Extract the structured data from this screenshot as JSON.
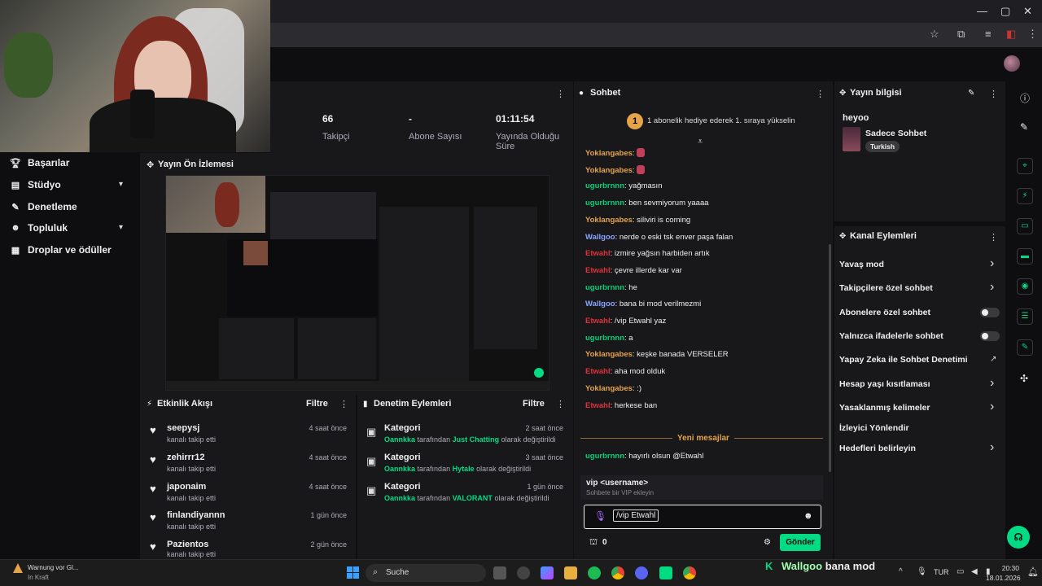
{
  "stats": [
    {
      "value": "66",
      "label": "Takipçi"
    },
    {
      "value": "-",
      "label": "Abone Sayısı"
    },
    {
      "value": "01:11:54",
      "label": "Yayında Olduğu Süre"
    }
  ],
  "sidebar": {
    "items": [
      {
        "label": "Başarılar",
        "icon": "trophy-icon"
      },
      {
        "label": "Stüdyo",
        "icon": "studio-icon"
      },
      {
        "label": "Denetleme",
        "icon": "wrench-icon"
      },
      {
        "label": "Topluluk",
        "icon": "community-icon"
      },
      {
        "label": "Droplar ve ödüller",
        "icon": "gift-icon"
      }
    ]
  },
  "preview": {
    "title": "Yayın Ön İzlemesi"
  },
  "activity": {
    "title": "Etkinlik Akışı",
    "filter": "Filtre",
    "items": [
      {
        "name": "seepysj",
        "sub": "kanalı takip etti",
        "time": "4 saat önce"
      },
      {
        "name": "zehirrr12",
        "sub": "kanalı takip etti",
        "time": "4 saat önce"
      },
      {
        "name": "japonaim",
        "sub": "kanalı takip etti",
        "time": "4 saat önce"
      },
      {
        "name": "finlandiyannn",
        "sub": "kanalı takip etti",
        "time": "1 gün önce"
      },
      {
        "name": "Pazientos",
        "sub": "kanalı takip etti",
        "time": "2 gün önce"
      }
    ]
  },
  "moderation": {
    "title": "Denetim Eylemleri",
    "filter": "Filtre",
    "items": [
      {
        "title": "Kategori",
        "user": "Oannkka",
        "mid": "tarafından",
        "cat": "Just Chatting",
        "end": "olarak değiştirildi",
        "time": "2 saat önce"
      },
      {
        "title": "Kategori",
        "user": "Oannkka",
        "mid": "tarafından",
        "cat": "Hytale",
        "end": "olarak değiştirildi",
        "time": "3 saat önce"
      },
      {
        "title": "Kategori",
        "user": "Oannkka",
        "mid": "tarafından",
        "cat": "VALORANT",
        "end": "olarak değiştirildi",
        "time": "1 gün önce"
      }
    ]
  },
  "chat": {
    "title": "Sohbet",
    "hype_count": "1",
    "hype_text": "1 abonelik hediye ederek 1. sıraya yükselin",
    "messages": [
      {
        "user": "Yoklangabes",
        "sep": ":",
        "text": "",
        "cls": "u-yok",
        "emote": true
      },
      {
        "user": "Yoklangabes",
        "sep": ":",
        "text": "",
        "cls": "u-yok",
        "emote": true
      },
      {
        "user": "ugurbrnnn",
        "sep": ":",
        "text": " yağmasın",
        "cls": "u-ugu"
      },
      {
        "user": "ugurbrnnn",
        "sep": ":",
        "text": " ben sevmiyorum yaaaa",
        "cls": "u-ugu"
      },
      {
        "user": "Yoklangabes",
        "sep": ":",
        "text": " siliviri is coming",
        "cls": "u-yok"
      },
      {
        "user": "Wallgoo",
        "sep": ":",
        "text": " nerde o eski tsk enver paşa falan",
        "cls": "u-wal"
      },
      {
        "user": "Etwahl",
        "sep": ":",
        "text": " izmire yağsın harbiden artık",
        "cls": "u-etw"
      },
      {
        "user": "Etwahl",
        "sep": ":",
        "text": " çevre illerde kar var",
        "cls": "u-etw"
      },
      {
        "user": "ugurbrnnn",
        "sep": ":",
        "text": " he",
        "cls": "u-ugu"
      },
      {
        "user": "Wallgoo",
        "sep": ":",
        "text": " bana bi mod verilmezmi",
        "cls": "u-wal"
      },
      {
        "user": "Etwahl",
        "sep": ":",
        "text": " /vip Etwahl yaz",
        "cls": "u-etw"
      },
      {
        "user": "ugurbrnnn",
        "sep": ":",
        "text": " a",
        "cls": "u-ugu"
      },
      {
        "user": "Yoklangabes",
        "sep": ":",
        "text": " keşke banada VERSELER",
        "cls": "u-yok"
      },
      {
        "user": "Etwahl",
        "sep": ":",
        "text": " aha mod olduk",
        "cls": "u-etw"
      },
      {
        "user": "Yoklangabes",
        "sep": ":",
        "text": " :)",
        "cls": "u-yok"
      },
      {
        "user": "Etwahl",
        "sep": ":",
        "text": " herkese ban",
        "cls": "u-etw"
      }
    ],
    "new_messages": "Yeni mesajlar",
    "after": {
      "user": "ugurbrnnn",
      "sep": ":",
      "text": " hayırlı olsun @Etwahl"
    },
    "command": {
      "name": "vip <username>",
      "desc": "Sohbete bir VIP ekleyin"
    },
    "input_value": "/vip Etwahl",
    "points": "0",
    "send": "Gönder"
  },
  "stream_info": {
    "title": "Yayın bilgisi",
    "stream_title": "heyoo",
    "category": "Sadece Sohbet",
    "tag": "Turkish"
  },
  "channel_actions": {
    "title": "Kanal Eylemleri",
    "items": [
      {
        "label": "Yavaş mod",
        "control": "arrow"
      },
      {
        "label": "Takipçilere özel sohbet",
        "control": "arrow"
      },
      {
        "label": "Abonelere özel sohbet",
        "control": "toggle"
      },
      {
        "label": "Yalnızca ifadelerle sohbet",
        "control": "toggle"
      },
      {
        "label": "Yapay Zeka ile Sohbet Denetimi",
        "control": "external"
      },
      {
        "label": "Hesap yaşı kısıtlaması",
        "control": "arrow"
      },
      {
        "label": "Yasaklanmış kelimeler",
        "control": "arrow"
      },
      {
        "label": "İzleyici Yönlendir",
        "control": "none"
      },
      {
        "label": "Hedefleri belirleyin",
        "control": "arrow"
      }
    ]
  },
  "taskbar": {
    "notification_title": "Warnung vor Gl...",
    "notification_sub": "In Kraft",
    "search": "Suche",
    "overlay_user": "Wallgoo",
    "overlay_text": "bana mod",
    "lang": "TUR",
    "time": "20:30",
    "date": "18.01.2026"
  },
  "colors": {
    "accent": "#00db84",
    "bg": "#0e0e10",
    "panel": "#18181b"
  }
}
